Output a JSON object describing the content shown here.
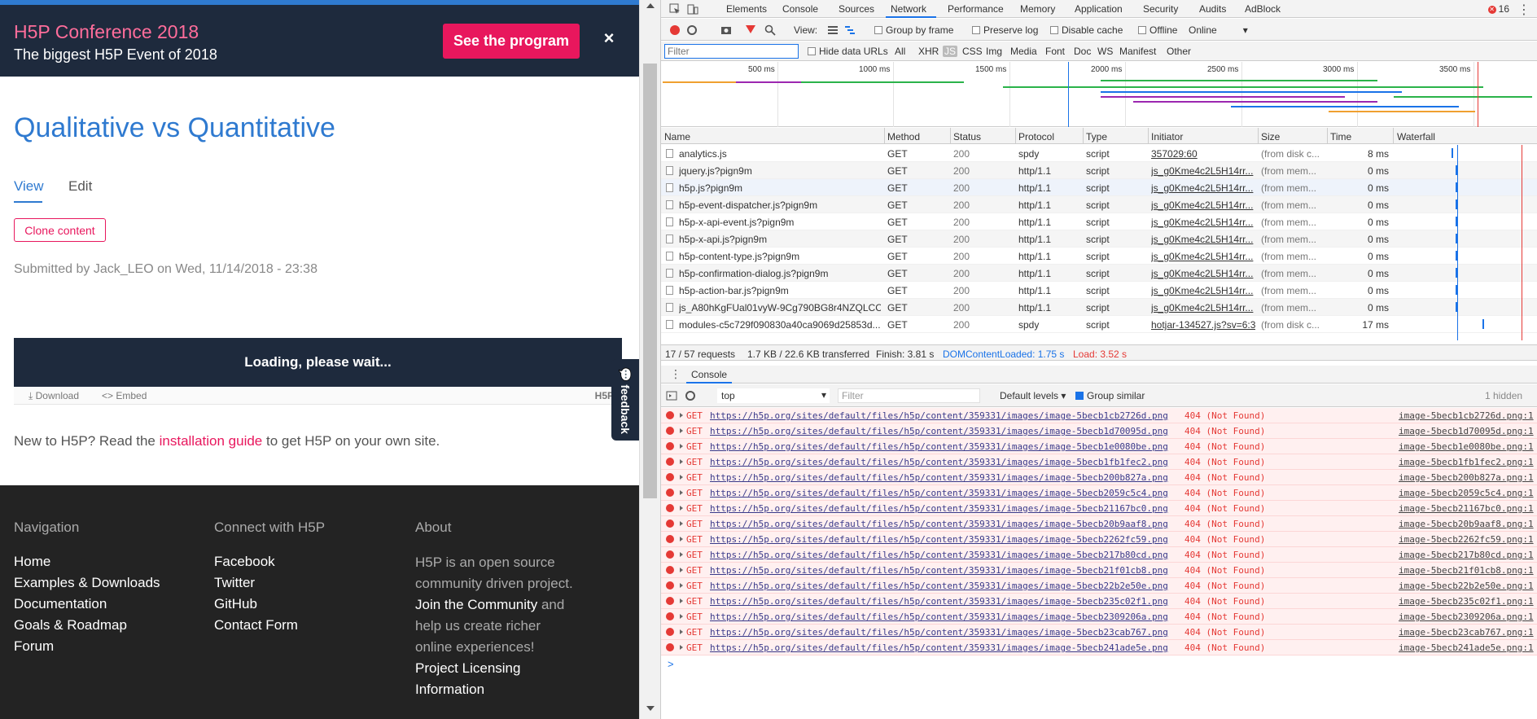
{
  "promo": {
    "title": "H5P Conference 2018",
    "subtitle": "The biggest H5P Event of 2018",
    "button": "See the program",
    "close": "×"
  },
  "content": {
    "title": "Qualitative vs Quantitative",
    "tabs": [
      "View",
      "Edit"
    ],
    "clone_button": "Clone content",
    "submitted": "Submitted by Jack_LEO on Wed, 11/14/2018 - 23:38",
    "loading": "Loading, please wait...",
    "actions": {
      "download": "⤓ Download",
      "embed": "<> Embed",
      "logo": "H5P"
    },
    "feedback": "💬 feedback",
    "newto_pre": "New to H5P? Read the ",
    "newto_link": "installation guide",
    "newto_post": " to get H5P on your own site."
  },
  "footer": {
    "nav_heading": "Navigation",
    "nav": [
      "Home",
      "Examples & Downloads",
      "Documentation",
      "Goals & Roadmap",
      "Forum"
    ],
    "connect_heading": "Connect with H5P",
    "connect": [
      "Facebook",
      "Twitter",
      "GitHub",
      "Contact Form"
    ],
    "about_heading": "About",
    "about_1": "H5P is an open source community driven project.",
    "about_join": "Join the Community",
    "about_2": " and help us create richer online experiences!",
    "about_link": "Project Licensing Information"
  },
  "devtools": {
    "tabs": [
      "Elements",
      "Console",
      "Sources",
      "Network",
      "Performance",
      "Memory",
      "Application",
      "Security",
      "Audits",
      "AdBlock"
    ],
    "error_count": "16",
    "toolbar": {
      "view": "View:",
      "group_by_frame": "Group by frame",
      "preserve_log": "Preserve log",
      "disable_cache": "Disable cache",
      "offline": "Offline",
      "throttle": "Online"
    },
    "filter_placeholder": "Filter",
    "hide_data_urls": "Hide data URLs",
    "types": [
      "All",
      "XHR",
      "JS",
      "CSS",
      "Img",
      "Media",
      "Font",
      "Doc",
      "WS",
      "Manifest",
      "Other"
    ],
    "timeline_ticks": [
      "500 ms",
      "1000 ms",
      "1500 ms",
      "2000 ms",
      "2500 ms",
      "3000 ms",
      "3500 ms"
    ],
    "columns": [
      "Name",
      "Method",
      "Status",
      "Protocol",
      "Type",
      "Initiator",
      "Size",
      "Time",
      "Waterfall"
    ],
    "requests": [
      {
        "name": "analytics.js",
        "method": "GET",
        "status": "200",
        "protocol": "spdy",
        "type": "script",
        "initiator": "357029:60",
        "size": "(from disk c...",
        "time": "8 ms"
      },
      {
        "name": "jquery.js?pign9m",
        "method": "GET",
        "status": "200",
        "protocol": "http/1.1",
        "type": "script",
        "initiator": "js_g0Kme4c2L5H14rr...",
        "size": "(from mem...",
        "time": "0 ms"
      },
      {
        "name": "h5p.js?pign9m",
        "method": "GET",
        "status": "200",
        "protocol": "http/1.1",
        "type": "script",
        "initiator": "js_g0Kme4c2L5H14rr...",
        "size": "(from mem...",
        "time": "0 ms"
      },
      {
        "name": "h5p-event-dispatcher.js?pign9m",
        "method": "GET",
        "status": "200",
        "protocol": "http/1.1",
        "type": "script",
        "initiator": "js_g0Kme4c2L5H14rr...",
        "size": "(from mem...",
        "time": "0 ms"
      },
      {
        "name": "h5p-x-api-event.js?pign9m",
        "method": "GET",
        "status": "200",
        "protocol": "http/1.1",
        "type": "script",
        "initiator": "js_g0Kme4c2L5H14rr...",
        "size": "(from mem...",
        "time": "0 ms"
      },
      {
        "name": "h5p-x-api.js?pign9m",
        "method": "GET",
        "status": "200",
        "protocol": "http/1.1",
        "type": "script",
        "initiator": "js_g0Kme4c2L5H14rr...",
        "size": "(from mem...",
        "time": "0 ms"
      },
      {
        "name": "h5p-content-type.js?pign9m",
        "method": "GET",
        "status": "200",
        "protocol": "http/1.1",
        "type": "script",
        "initiator": "js_g0Kme4c2L5H14rr...",
        "size": "(from mem...",
        "time": "0 ms"
      },
      {
        "name": "h5p-confirmation-dialog.js?pign9m",
        "method": "GET",
        "status": "200",
        "protocol": "http/1.1",
        "type": "script",
        "initiator": "js_g0Kme4c2L5H14rr...",
        "size": "(from mem...",
        "time": "0 ms"
      },
      {
        "name": "h5p-action-bar.js?pign9m",
        "method": "GET",
        "status": "200",
        "protocol": "http/1.1",
        "type": "script",
        "initiator": "js_g0Kme4c2L5H14rr...",
        "size": "(from mem...",
        "time": "0 ms"
      },
      {
        "name": "js_A80hKgFUal01vyW-9Cg790BG8r4NZQLCC...",
        "method": "GET",
        "status": "200",
        "protocol": "http/1.1",
        "type": "script",
        "initiator": "js_g0Kme4c2L5H14rr...",
        "size": "(from mem...",
        "time": "0 ms"
      },
      {
        "name": "modules-c5c729f090830a40ca9069d25853d...",
        "method": "GET",
        "status": "200",
        "protocol": "spdy",
        "type": "script",
        "initiator": "hotjar-134527.js?sv=6:3",
        "size": "(from disk c...",
        "time": "17 ms"
      }
    ],
    "status": {
      "requests": "17 / 57 requests",
      "transferred": "1.7 KB / 22.6 KB transferred",
      "finish": "Finish: 3.81 s",
      "dcl": "DOMContentLoaded: 1.75 s",
      "load": "Load: 3.52 s"
    },
    "console": {
      "tab": "Console",
      "context": "top",
      "filter_placeholder": "Filter",
      "levels": "Default levels ▾",
      "group_similar": "Group similar",
      "hidden": "1 hidden",
      "messages": [
        {
          "url": "https://h5p.org/sites/default/files/h5p/content/359331/images/image-5becb1cb2726d.png",
          "src": "image-5becb1cb2726d.png:1"
        },
        {
          "url": "https://h5p.org/sites/default/files/h5p/content/359331/images/image-5becb1d70095d.png",
          "src": "image-5becb1d70095d.png:1"
        },
        {
          "url": "https://h5p.org/sites/default/files/h5p/content/359331/images/image-5becb1e0080be.png",
          "src": "image-5becb1e0080be.png:1"
        },
        {
          "url": "https://h5p.org/sites/default/files/h5p/content/359331/images/image-5becb1fb1fec2.png",
          "src": "image-5becb1fb1fec2.png:1"
        },
        {
          "url": "https://h5p.org/sites/default/files/h5p/content/359331/images/image-5becb200b827a.png",
          "src": "image-5becb200b827a.png:1"
        },
        {
          "url": "https://h5p.org/sites/default/files/h5p/content/359331/images/image-5becb2059c5c4.png",
          "src": "image-5becb2059c5c4.png:1"
        },
        {
          "url": "https://h5p.org/sites/default/files/h5p/content/359331/images/image-5becb21167bc0.png",
          "src": "image-5becb21167bc0.png:1"
        },
        {
          "url": "https://h5p.org/sites/default/files/h5p/content/359331/images/image-5becb20b9aaf8.png",
          "src": "image-5becb20b9aaf8.png:1"
        },
        {
          "url": "https://h5p.org/sites/default/files/h5p/content/359331/images/image-5becb2262fc59.png",
          "src": "image-5becb2262fc59.png:1"
        },
        {
          "url": "https://h5p.org/sites/default/files/h5p/content/359331/images/image-5becb217b80cd.png",
          "src": "image-5becb217b80cd.png:1"
        },
        {
          "url": "https://h5p.org/sites/default/files/h5p/content/359331/images/image-5becb21f01cb8.png",
          "src": "image-5becb21f01cb8.png:1"
        },
        {
          "url": "https://h5p.org/sites/default/files/h5p/content/359331/images/image-5becb22b2e50e.png",
          "src": "image-5becb22b2e50e.png:1"
        },
        {
          "url": "https://h5p.org/sites/default/files/h5p/content/359331/images/image-5becb235c02f1.png",
          "src": "image-5becb235c02f1.png:1"
        },
        {
          "url": "https://h5p.org/sites/default/files/h5p/content/359331/images/image-5becb2309206a.png",
          "src": "image-5becb2309206a.png:1"
        },
        {
          "url": "https://h5p.org/sites/default/files/h5p/content/359331/images/image-5becb23cab767.png",
          "src": "image-5becb23cab767.png:1"
        },
        {
          "url": "https://h5p.org/sites/default/files/h5p/content/359331/images/image-5becb241ade5e.png",
          "src": "image-5becb241ade5e.png:1"
        }
      ],
      "verb": "GET",
      "code": "404 (Not Found)",
      "prompt": ">"
    },
    "colors": {
      "accent": "#1a73e8",
      "error": "#e53935",
      "brand_pink": "#e8175d",
      "brand_blue": "#2f7ad0"
    }
  }
}
